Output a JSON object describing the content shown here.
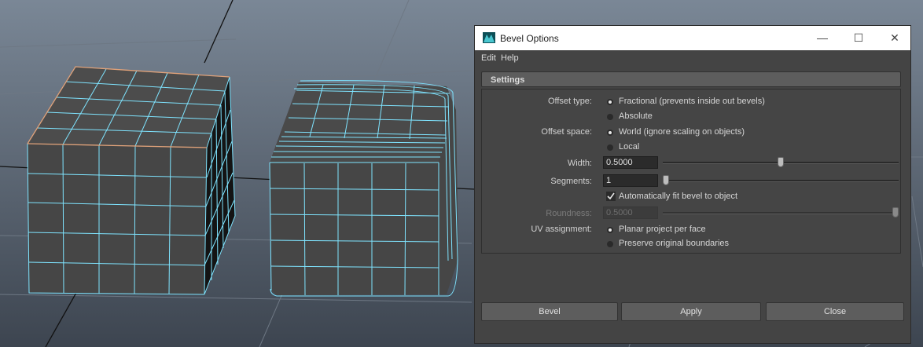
{
  "window": {
    "title": "Bevel Options"
  },
  "menu": {
    "items": [
      "Edit",
      "Help"
    ]
  },
  "settings": {
    "header": "Settings",
    "offset_type_label": "Offset type:",
    "offset_type_options": [
      "Fractional (prevents inside out bevels)",
      "Absolute"
    ],
    "offset_space_label": "Offset space:",
    "offset_space_options": [
      "World (ignore scaling on objects)",
      "Local"
    ],
    "width_label": "Width:",
    "width_value": "0.5000",
    "width_slider_fraction": 0.5,
    "segments_label": "Segments:",
    "segments_value": "1",
    "segments_slider_fraction": 0.0,
    "auto_fit_label": "Automatically fit bevel to object",
    "auto_fit_checked": true,
    "roundness_label": "Roundness:",
    "roundness_value": "0.5000",
    "roundness_slider_fraction": 1.0,
    "uv_label": "UV assignment:",
    "uv_options": [
      "Planar project per face",
      "Preserve original boundaries"
    ]
  },
  "buttons": {
    "bevel": "Bevel",
    "apply": "Apply",
    "close": "Close"
  },
  "colors": {
    "viewport_bg": "#5e6a78",
    "wire": "#7fe4ff",
    "edge_highlight": "#e0a27a",
    "dialog_bg": "#444444"
  }
}
